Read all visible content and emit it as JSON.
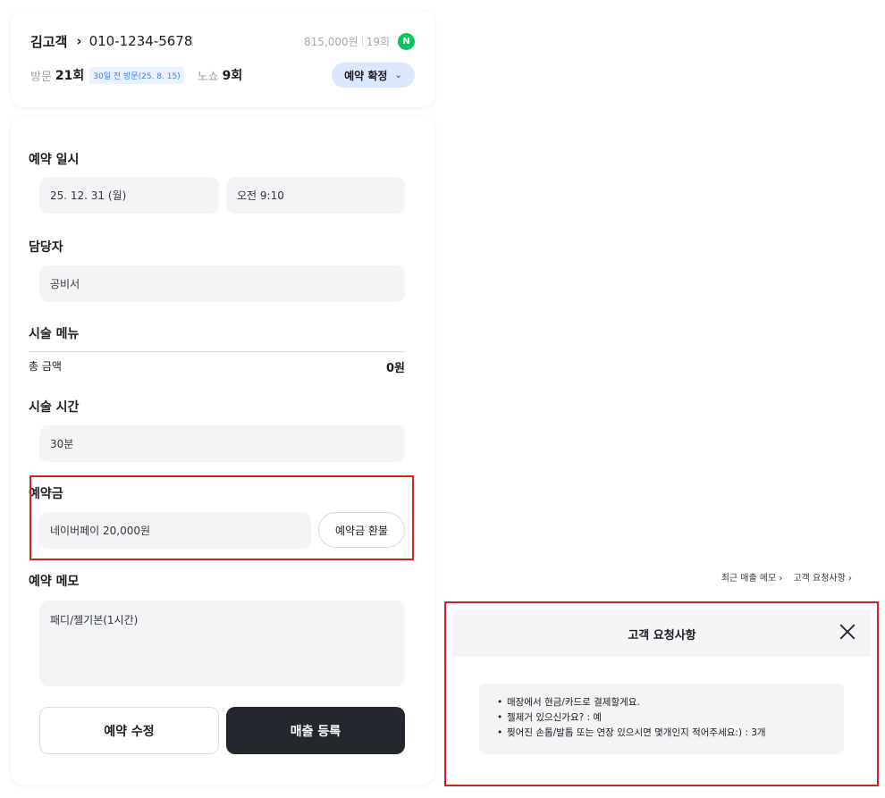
{
  "customer": {
    "name": "김고객",
    "chevron": "›",
    "phone": "010-1234-5678",
    "total_spent": "815,000원",
    "visit_count_short": "19회",
    "naver_badge": "N",
    "visits_label": "방문",
    "visits_value": "21회",
    "last_visit": "30일 전 방문(25. 8. 15)",
    "noshow_label": "노쇼",
    "noshow_value": "9회",
    "status": "예약 확정",
    "status_chevron": "⌄"
  },
  "form": {
    "date_title": "예약 일시",
    "date_value": "25. 12. 31 (월)",
    "time_value": "오전 9:10",
    "staff_title": "담당자",
    "staff_value": "공비서",
    "menu_title": "시술 메뉴",
    "total_label": "총 금액",
    "total_value": "0원",
    "duration_title": "시술 시간",
    "duration_value": "30분",
    "deposit_title": "예약금",
    "deposit_value": "네이버페이 20,000원",
    "refund_button": "예약금 환불",
    "memo_title": "예약 메모",
    "recent_memo_link": "최근 매출 메모 ›",
    "customer_request_link": "고객 요청사항 ›",
    "memo_value": "패디/젤기본(1시간)",
    "edit_button": "예약 수정",
    "sales_button": "매출 등록"
  },
  "modal": {
    "title": "고객 요청사항",
    "requests": [
      "매장에서 현금/카드로 결제할게요.",
      "젤제거 있으신가요? : 예",
      "찢어진 손톱/발톱 또는 연장 있으시면 몇개인지 적어주세요:) : 3개"
    ]
  },
  "colors": {
    "highlight": "#d71f1f",
    "primary_button": "#24272e",
    "status_pill": "#dbe7fd",
    "naver_green": "#03c75a"
  }
}
